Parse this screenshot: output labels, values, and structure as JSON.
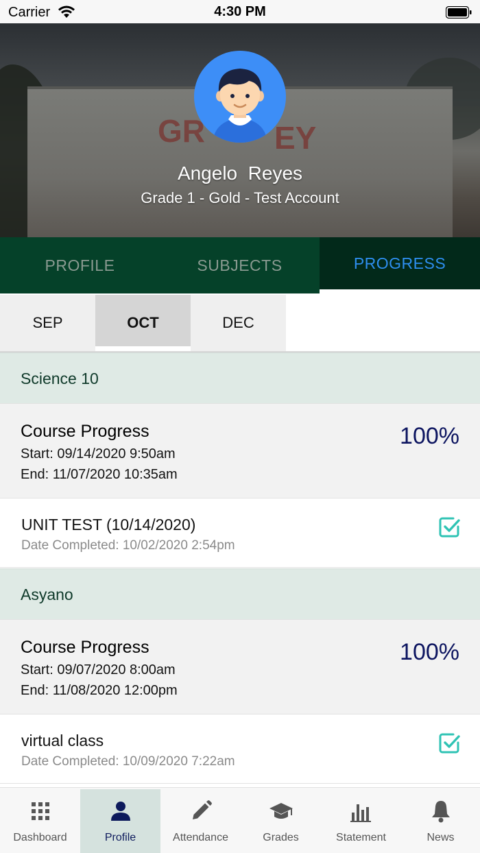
{
  "status_bar": {
    "carrier": "Carrier",
    "time": "4:30 PM"
  },
  "header": {
    "student_name": "Angelo  Reyes",
    "grade": "Grade 1 - Gold - Test Account"
  },
  "main_tabs": [
    {
      "label": "PROFILE",
      "active": false
    },
    {
      "label": "SUBJECTS",
      "active": false
    },
    {
      "label": "PROGRESS",
      "active": true
    }
  ],
  "month_tabs": [
    {
      "label": "SEP",
      "active": false
    },
    {
      "label": "OCT",
      "active": true
    },
    {
      "label": "DEC",
      "active": false
    }
  ],
  "subjects": [
    {
      "name": "Science 10",
      "course_progress": {
        "title": "Course Progress",
        "start": "Start: 09/14/2020 9:50am",
        "end": "End: 11/07/2020 10:35am",
        "percent": "100%"
      },
      "activity": {
        "title": "UNIT TEST (10/14/2020)",
        "date_completed": "Date Completed: 10/02/2020 2:54pm",
        "completed": true
      }
    },
    {
      "name": "Asyano",
      "course_progress": {
        "title": "Course Progress",
        "start": "Start: 09/07/2020 8:00am",
        "end": "End: 11/08/2020 12:00pm",
        "percent": "100%"
      },
      "activity": {
        "title": "virtual class",
        "date_completed": "Date Completed: 10/09/2020 7:22am",
        "completed": true
      }
    }
  ],
  "bottom_nav": [
    {
      "label": "Dashboard",
      "icon": "grid-icon",
      "active": false
    },
    {
      "label": "Profile",
      "icon": "person-icon",
      "active": true
    },
    {
      "label": "Attendance",
      "icon": "pencil-icon",
      "active": false
    },
    {
      "label": "Grades",
      "icon": "graduation-cap-icon",
      "active": false
    },
    {
      "label": "Statement",
      "icon": "bar-chart-icon",
      "active": false
    },
    {
      "label": "News",
      "icon": "bell-icon",
      "active": false
    }
  ],
  "colors": {
    "tab_bg": "#054129",
    "tab_active_bg": "#02291a",
    "tab_active_text": "#2e8ff0",
    "section_bg": "#dfeae5",
    "percent_text": "#0d1560",
    "check": "#2fc3b4",
    "avatar_bg": "#3d8ef7"
  }
}
